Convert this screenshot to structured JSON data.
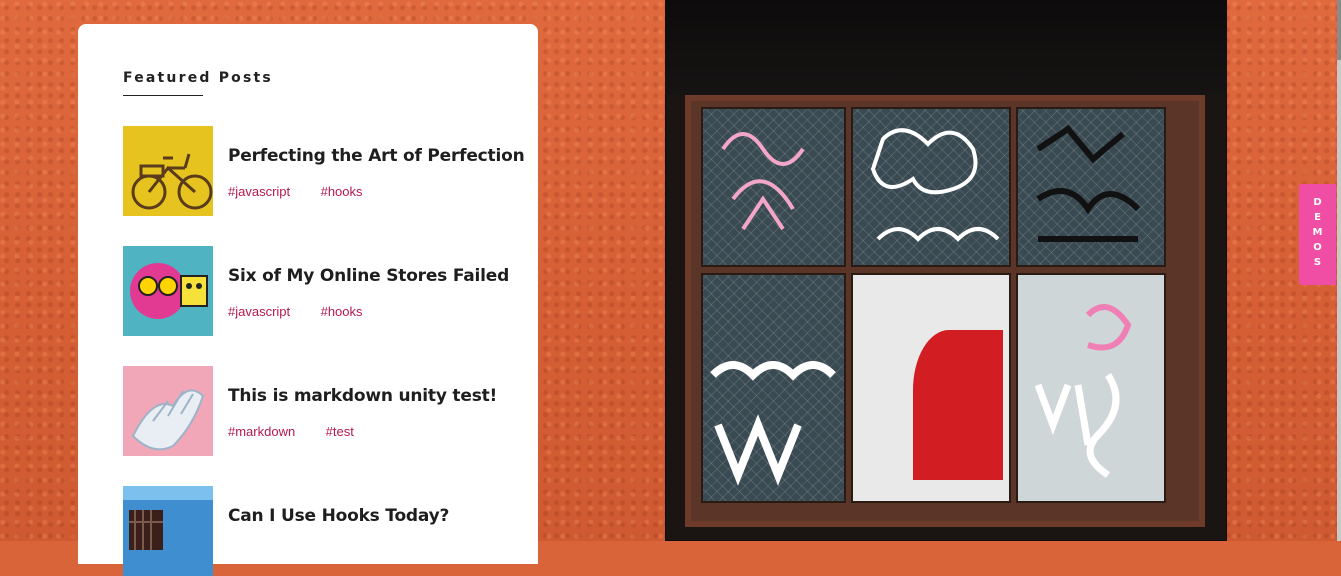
{
  "featured": {
    "title": "Featured Posts",
    "posts": [
      {
        "title": "Perfecting the Art of Perfection",
        "tags": [
          "#javascript",
          "#hooks"
        ],
        "thumb_icon": "bicycle-image"
      },
      {
        "title": "Six of My Online Stores Failed",
        "tags": [
          "#javascript",
          "#hooks"
        ],
        "thumb_icon": "pop-art-image"
      },
      {
        "title": "This is markdown unity test!",
        "tags": [
          "#markdown",
          "#test"
        ],
        "thumb_icon": "sculpture-hand-image"
      },
      {
        "title": "Can I Use Hooks Today?",
        "tags": [],
        "thumb_icon": "blue-building-image"
      }
    ]
  },
  "demos": {
    "label": "DEMOS"
  },
  "colors": {
    "tag": "#b5194f",
    "demos_bg": "#f04ea5",
    "wall": "#d9643a"
  }
}
